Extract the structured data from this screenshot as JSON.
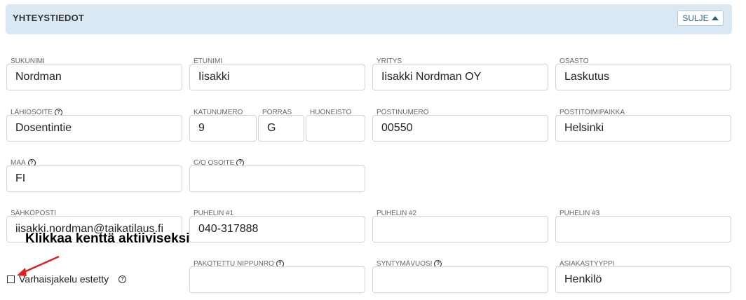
{
  "section": {
    "title": "YHTEYSTIEDOT",
    "close_label": "SULJE"
  },
  "fields": {
    "sukunimi": {
      "label": "SUKUNIMI",
      "value": "Nordman"
    },
    "etunimi": {
      "label": "ETUNIMI",
      "value": "Iisakki"
    },
    "yritys": {
      "label": "YRITYS",
      "value": "Iisakki Nordman OY"
    },
    "osasto": {
      "label": "OSASTO",
      "value": "Laskutus"
    },
    "lahiosoite": {
      "label": "LÄHIOSOITE",
      "value": "Dosentintie"
    },
    "katunumero": {
      "label": "KATUNUMERO",
      "value": "9"
    },
    "porras": {
      "label": "PORRAS",
      "value": "G"
    },
    "huoneisto": {
      "label": "HUONEISTO",
      "value": ""
    },
    "postinumero": {
      "label": "POSTINUMERO",
      "value": "00550"
    },
    "postitoimipaikka": {
      "label": "POSTITOIMIPAIKKA",
      "value": "Helsinki"
    },
    "maa": {
      "label": "MAA",
      "value": "FI"
    },
    "co_osoite": {
      "label": "C/O OSOITE",
      "value": ""
    },
    "sahkoposti": {
      "label": "SÄHKÖPOSTI",
      "value": "iisakki.nordman@taikatilaus.fi"
    },
    "puhelin1": {
      "label": "PUHELIN #1",
      "value": "040-317888"
    },
    "puhelin2": {
      "label": "PUHELIN #2",
      "value": ""
    },
    "puhelin3": {
      "label": "PUHELIN #3",
      "value": ""
    },
    "pakotettu_nippunro": {
      "label": "PAKOTETTU NIPPUNRO",
      "value": ""
    },
    "syntymavuosi": {
      "label": "SYNTYMÄVUOSI",
      "value": ""
    },
    "asiakastyyppi": {
      "label": "ASIAKASTYYPPI",
      "value": "Henkilö"
    }
  },
  "checkbox": {
    "label": "Varhaisjakelu estetty",
    "checked": false
  },
  "annotation": {
    "text": "Klikkaa kenttä aktiiviseksi",
    "color": "#e02020"
  },
  "help_icon": "?"
}
